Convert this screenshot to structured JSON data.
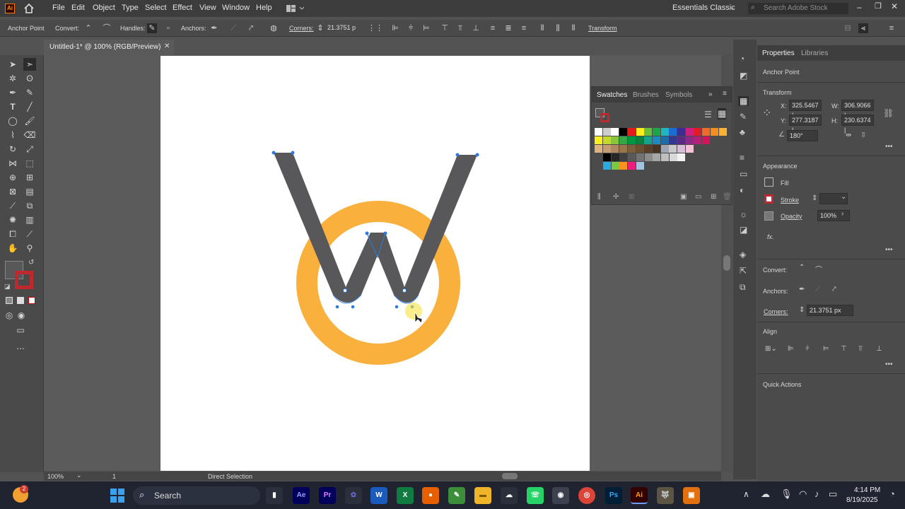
{
  "app": {
    "logo": "Ai"
  },
  "menu": [
    "File",
    "Edit",
    "Object",
    "Type",
    "Select",
    "Effect",
    "View",
    "Window",
    "Help"
  ],
  "workspace": "Essentials Classic",
  "search_stock": {
    "placeholder": "Search Adobe Stock"
  },
  "control_bar": {
    "context": "Anchor Point",
    "convert": "Convert:",
    "handles": "Handles:",
    "anchors": "Anchors:",
    "corners": "Corners:",
    "corners_value": "21.3751 p",
    "transform": "Transform"
  },
  "document_tab": {
    "title": "Untitled-1* @ 100% (RGB/Preview)"
  },
  "swatches_panel": {
    "tabs": [
      "Swatches",
      "Brushes",
      "Symbols"
    ]
  },
  "properties_panel": {
    "tabs": [
      "Properties",
      "Libraries"
    ],
    "selection": "Anchor Point",
    "transform": {
      "title": "Transform",
      "x_label": "X:",
      "x": "325.5467 |",
      "y_label": "Y:",
      "y": "277.3187 |",
      "w_label": "W:",
      "w": "306.9066 |",
      "h_label": "H:",
      "h": "230.6374 |",
      "angle": "180°"
    },
    "appearance": {
      "title": "Appearance",
      "fill": "Fill",
      "stroke": "Stroke",
      "opacity": "Opacity",
      "opacity_value": "100%",
      "fx": "fx."
    },
    "convert": "Convert:",
    "anchors": "Anchors:",
    "corners": "Corners:",
    "corners_value": "21.3751 px",
    "align": "Align",
    "quick_actions": "Quick Actions"
  },
  "status_bar": {
    "zoom": "100%",
    "artboard": "1",
    "tool": "Direct Selection"
  },
  "taskbar": {
    "search": "Search",
    "badge": "2",
    "time": "4:14 PM",
    "date": "8/19/2025",
    "apps": [
      "Ae",
      "Pr",
      "Ps",
      "Ai"
    ]
  },
  "colors": {
    "artwork_gray": "#58585a",
    "artwork_orange": "#f9b03c",
    "accent": "#2d7be0"
  }
}
